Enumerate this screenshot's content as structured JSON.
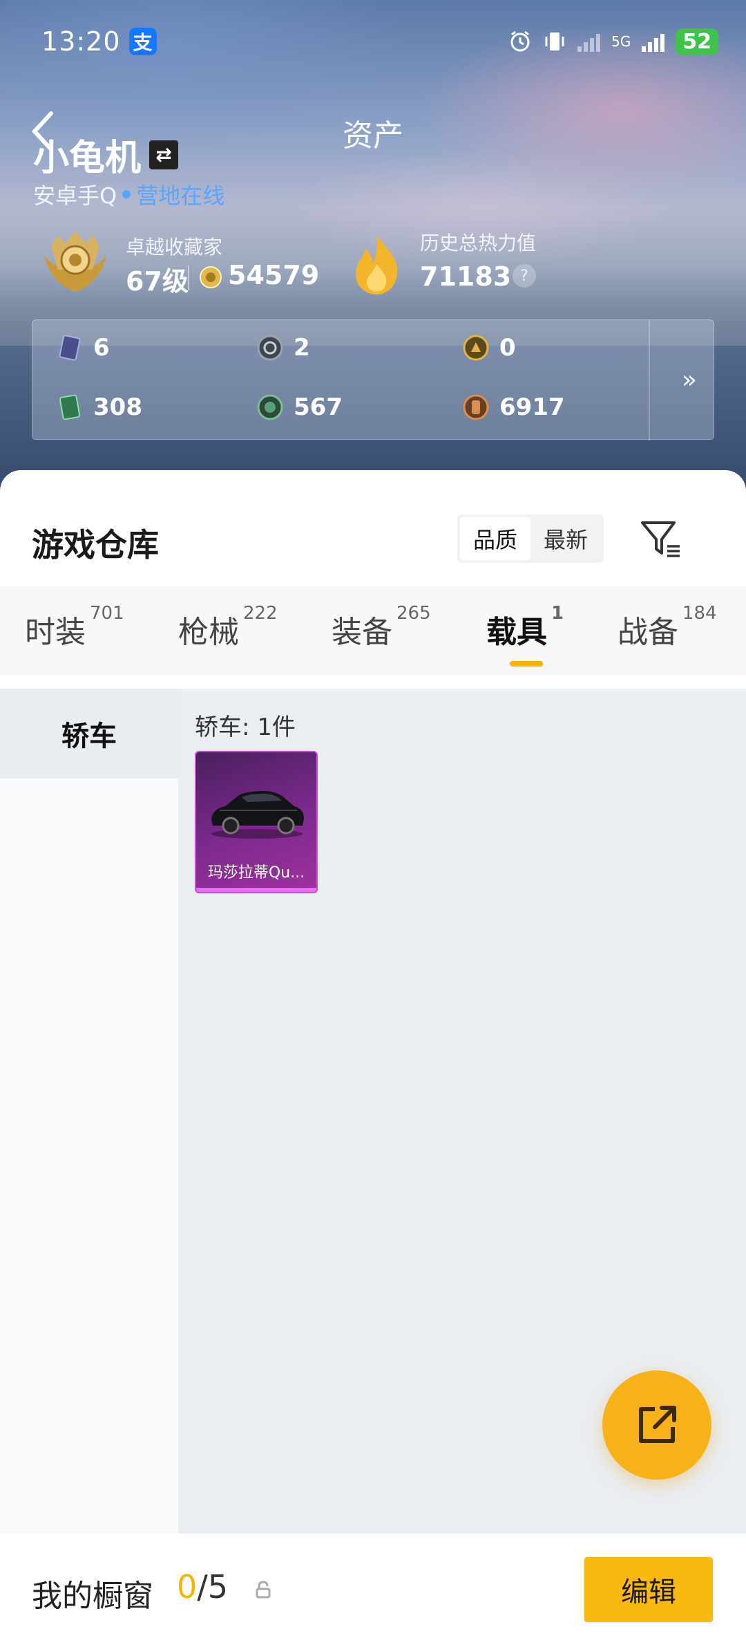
{
  "status_bar": {
    "time": "13:20",
    "alipay_glyph": "支",
    "network": "5G",
    "battery": "52"
  },
  "header": {
    "title": "资产",
    "username": "小龟机",
    "switch_glyph": "⇄",
    "platform": "安卓手Q",
    "online_status": "营地在线"
  },
  "rank": {
    "title": "卓越收藏家",
    "level": "67级",
    "coins": "54579"
  },
  "heat": {
    "title": "历史总热力值",
    "value": "71183",
    "help": "?"
  },
  "assets": {
    "items": [
      {
        "icon": "card-icon",
        "value": "6"
      },
      {
        "icon": "silver-coin-icon",
        "value": "2"
      },
      {
        "icon": "gold-coin-icon",
        "value": "0"
      },
      {
        "icon": "ticket-icon",
        "value": "308"
      },
      {
        "icon": "gem-icon",
        "value": "567"
      },
      {
        "icon": "bronze-token-icon",
        "value": "6917"
      }
    ],
    "more": "»"
  },
  "warehouse": {
    "title": "游戏仓库",
    "sort_options": [
      "品质",
      "最新"
    ],
    "sort_active": "品质"
  },
  "tabs": [
    {
      "label": "时装",
      "count": "701"
    },
    {
      "label": "枪械",
      "count": "222"
    },
    {
      "label": "装备",
      "count": "265"
    },
    {
      "label": "载具",
      "count": "1"
    },
    {
      "label": "战备",
      "count": "184"
    }
  ],
  "active_tab": "载具",
  "sidebar": {
    "items": [
      {
        "label": "轿车"
      }
    ]
  },
  "content": {
    "group_label": "轿车: 1件",
    "items": [
      {
        "name": "玛莎拉蒂Qu...",
        "rarity_color": "#a0309e"
      }
    ]
  },
  "footer": {
    "label": "我的橱窗",
    "used": "0",
    "total": "/5",
    "edit": "编辑"
  },
  "colors": {
    "accent": "#f5b400",
    "online": "#5aa3ff",
    "rarity_purple": "#a0309e"
  }
}
